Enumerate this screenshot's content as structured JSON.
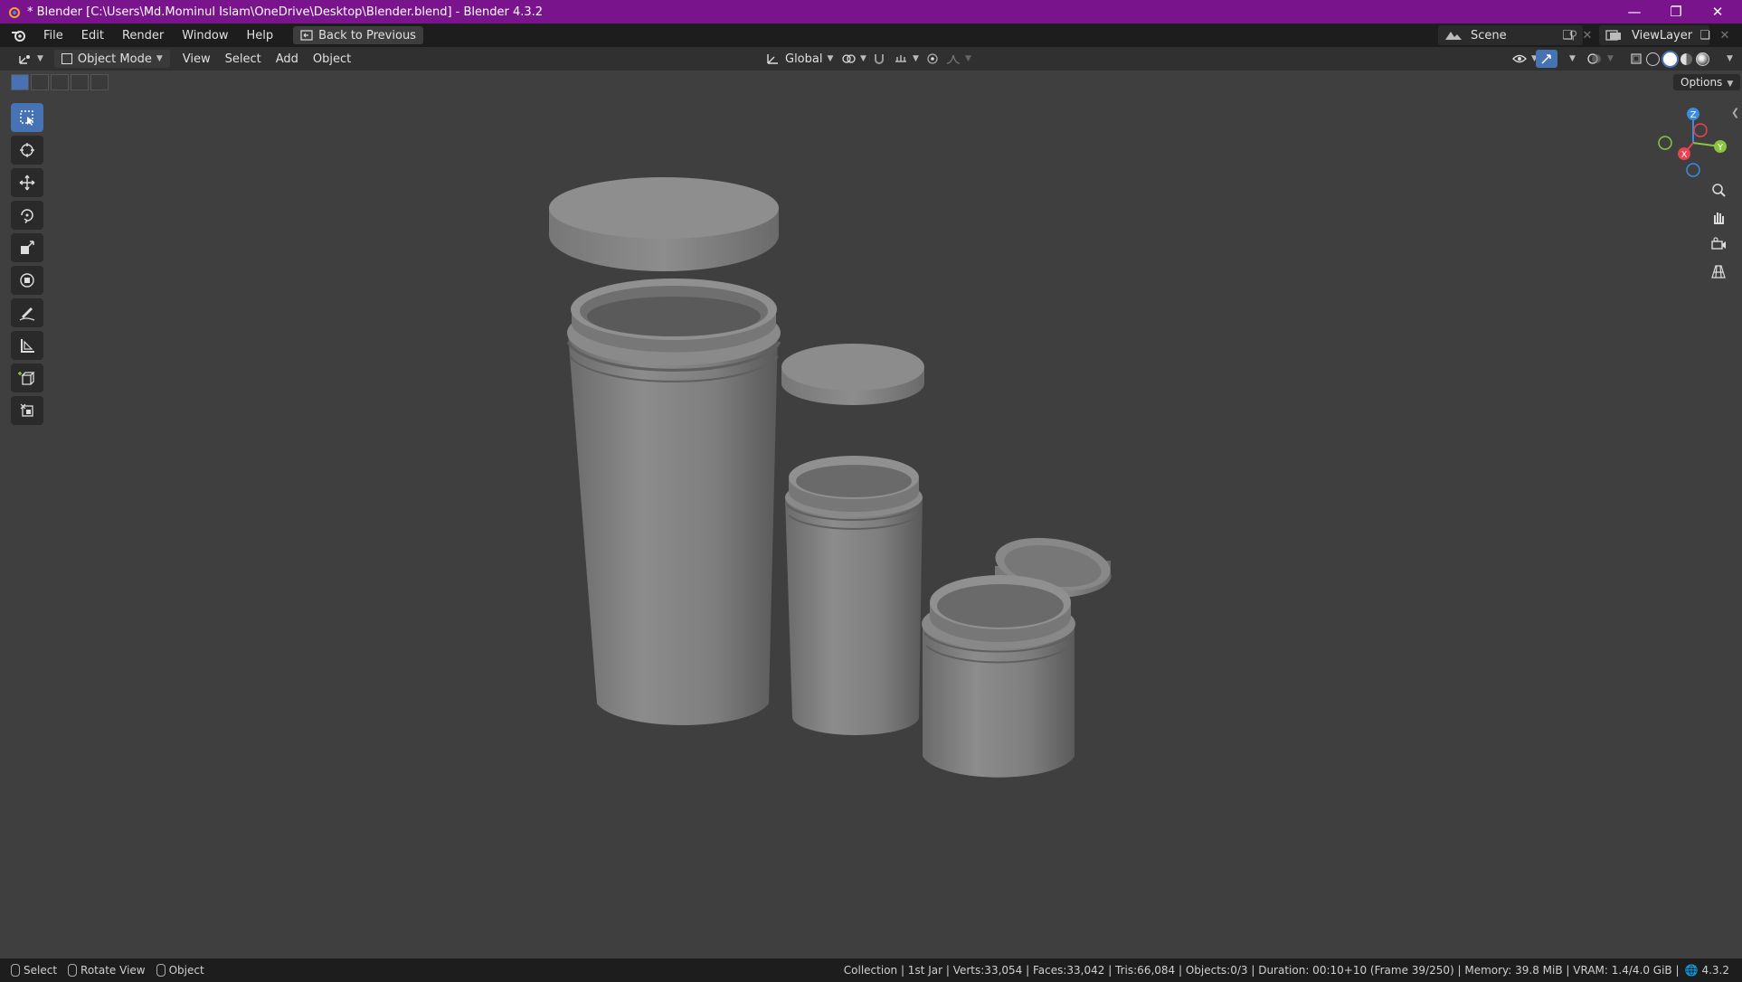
{
  "window": {
    "title": "* Blender [C:\\Users\\Md.Mominul Islam\\OneDrive\\Desktop\\Blender.blend] - Blender 4.3.2",
    "controls": [
      "minimize-icon",
      "restore-icon",
      "close-icon"
    ]
  },
  "menubar": {
    "items": [
      "File",
      "Edit",
      "Render",
      "Window",
      "Help"
    ],
    "back_label": "Back to Previous",
    "scene": "Scene",
    "view_layer": "ViewLayer"
  },
  "header": {
    "mode": "Object Mode",
    "menus": [
      "View",
      "Select",
      "Add",
      "Object"
    ],
    "orientation": "Global",
    "options_label": "Options"
  },
  "tools": [
    "select-box-icon",
    "cursor-icon",
    "move-icon",
    "rotate-icon",
    "scale-icon",
    "transform-icon",
    "annotate-icon",
    "measure-icon",
    "add-cube-icon",
    "add-object-icon"
  ],
  "gizmo": {
    "x": "X",
    "y": "Y",
    "z": "Z"
  },
  "statusbar": {
    "select": "Select",
    "rotate": "Rotate View",
    "object": "Object",
    "info": "Collection | 1st Jar | Verts:33,054 | Faces:33,042 | Tris:66,084 | Objects:0/3 | Duration: 00:10+10 (Frame 39/250) | Memory: 39.8 MiB | VRAM: 1.4/4.0 GiB |",
    "version": "4.3.2"
  },
  "colors": {
    "title_bar": "#7a148c",
    "active_tool": "#4772b3",
    "viewport_bg": "#3f3f3f",
    "axis_x": "#e8434f",
    "axis_y": "#8bc53f",
    "axis_z": "#3a8cde"
  }
}
